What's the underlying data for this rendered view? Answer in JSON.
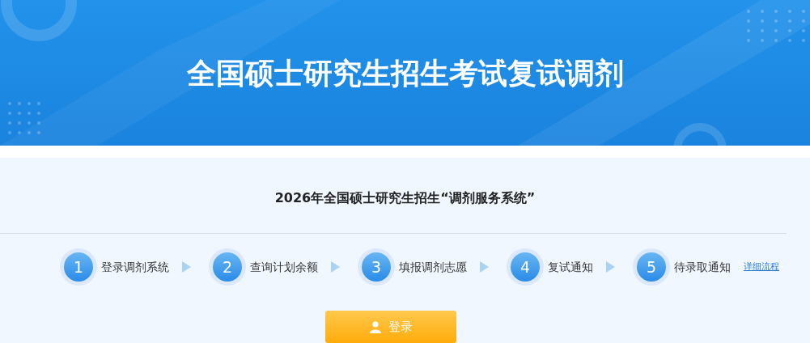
{
  "banner": {
    "title": "全国硕士研究生招生考试复试调剂"
  },
  "subtitle": "2026年全国硕士研究生招生“调剂服务系统”",
  "steps": [
    {
      "number": "1",
      "label": "登录调剂系统"
    },
    {
      "number": "2",
      "label": "查询计划余额"
    },
    {
      "number": "3",
      "label": "填报调剂志愿"
    },
    {
      "number": "4",
      "label": "复试通知"
    },
    {
      "number": "5",
      "label": "待录取通知"
    }
  ],
  "details_link": "详细流程",
  "login_button": "登录"
}
